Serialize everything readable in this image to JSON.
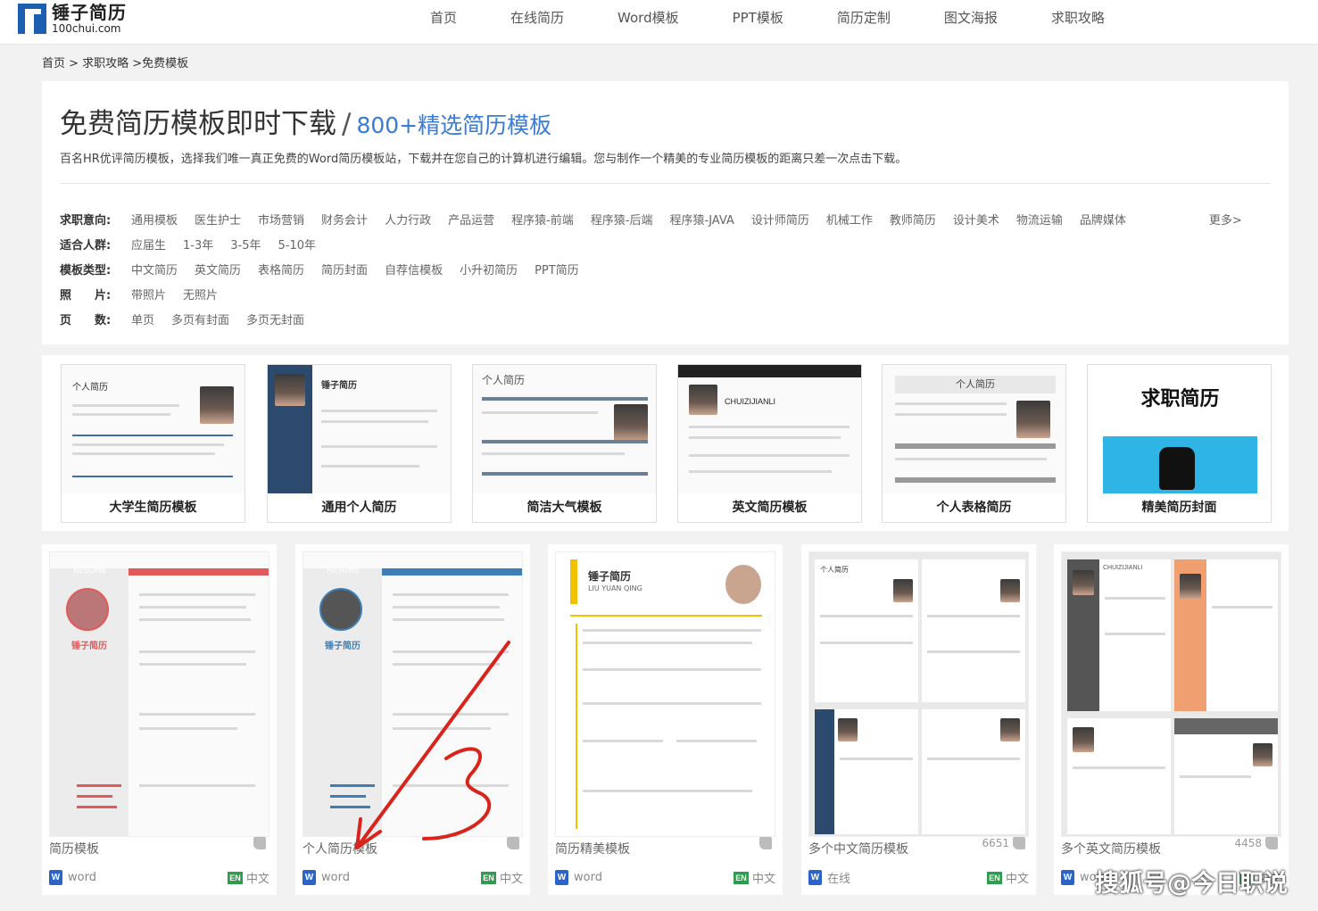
{
  "header": {
    "logo_cn": "锤子简历",
    "logo_en": "100chui.com",
    "nav": [
      "首页",
      "在线简历",
      "Word模板",
      "PPT模板",
      "简历定制",
      "图文海报",
      "求职攻略"
    ]
  },
  "breadcrumb": "首页 > 求职攻略 >免费模板",
  "intro": {
    "title": "免费简历模板即时下载",
    "slash": "/",
    "subtitle": "800+精选简历模板",
    "description": "百名HR优评简历模板，选择我们唯一真正免费的Word简历模板站，下载并在您自己的计算机进行编辑。您与制作一个精美的专业简历模板的距离只差一次点击下载。"
  },
  "filters": [
    {
      "label": "求职意向:",
      "options": [
        "通用模板",
        "医生护士",
        "市场营销",
        "财务会计",
        "人力行政",
        "产品运营",
        "程序猿-前端",
        "程序猿-后端",
        "程序猿-JAVA",
        "设计师简历",
        "机械工作",
        "教师简历",
        "设计美术",
        "物流运输",
        "品牌媒体"
      ],
      "more": "更多>"
    },
    {
      "label": "适合人群:",
      "options": [
        "应届生",
        "1-3年",
        "3-5年",
        "5-10年"
      ]
    },
    {
      "label": "模板类型:",
      "options": [
        "中文简历",
        "英文简历",
        "表格简历",
        "简历封面",
        "自荐信模板",
        "小升初简历",
        "PPT简历"
      ]
    },
    {
      "label": "照　　片:",
      "options": [
        "带照片",
        "无照片"
      ]
    },
    {
      "label": "页　　数:",
      "options": [
        "单页",
        "多页有封面",
        "多页无封面"
      ]
    }
  ],
  "categories": [
    {
      "label": "大学生简历模板",
      "thumb_title": "个人简历"
    },
    {
      "label": "通用个人简历",
      "thumb_title": "锤子简历"
    },
    {
      "label": "简洁大气模板",
      "thumb_title": "个人简历"
    },
    {
      "label": "英文简历模板",
      "thumb_title": "CHUIZIJIANLI"
    },
    {
      "label": "个人表格简历",
      "thumb_title": "个人简历"
    },
    {
      "label": "精美简历封面",
      "thumb_title": "求职简历"
    }
  ],
  "templates": [
    {
      "name": "简历模板",
      "likes": "",
      "format": "word",
      "lang_badge": "EN",
      "lang": "中文",
      "thumb_title": "锤子简历",
      "banner": "RESUME"
    },
    {
      "name": "个人简历模板",
      "likes": "",
      "format": "word",
      "lang_badge": "EN",
      "lang": "中文",
      "thumb_title": "锤子简历",
      "banner": "RESUME"
    },
    {
      "name": "简历精美模板",
      "likes": "",
      "format": "word",
      "lang_badge": "EN",
      "lang": "中文",
      "thumb_title": "锤子简历",
      "banner": "LIU YUAN QING"
    },
    {
      "name": "多个中文简历模板",
      "likes": "6651",
      "format": "在线",
      "lang_badge": "EN",
      "lang": "中文",
      "thumb_title": "个人简历",
      "banner": ""
    },
    {
      "name": "多个英文简历模板",
      "likes": "4458",
      "format": "word",
      "lang_badge": "EN",
      "lang": "中文",
      "thumb_title": "CHUIZIJIANLI",
      "banner": ""
    }
  ],
  "watermark": "搜狐号@今日职说",
  "colors": {
    "accent": "#3a7bd5",
    "word": "#2b63c7",
    "badge_green": "#2e9d4f",
    "resume_red": "#e05a5a",
    "resume_blue": "#3d7fb5"
  }
}
